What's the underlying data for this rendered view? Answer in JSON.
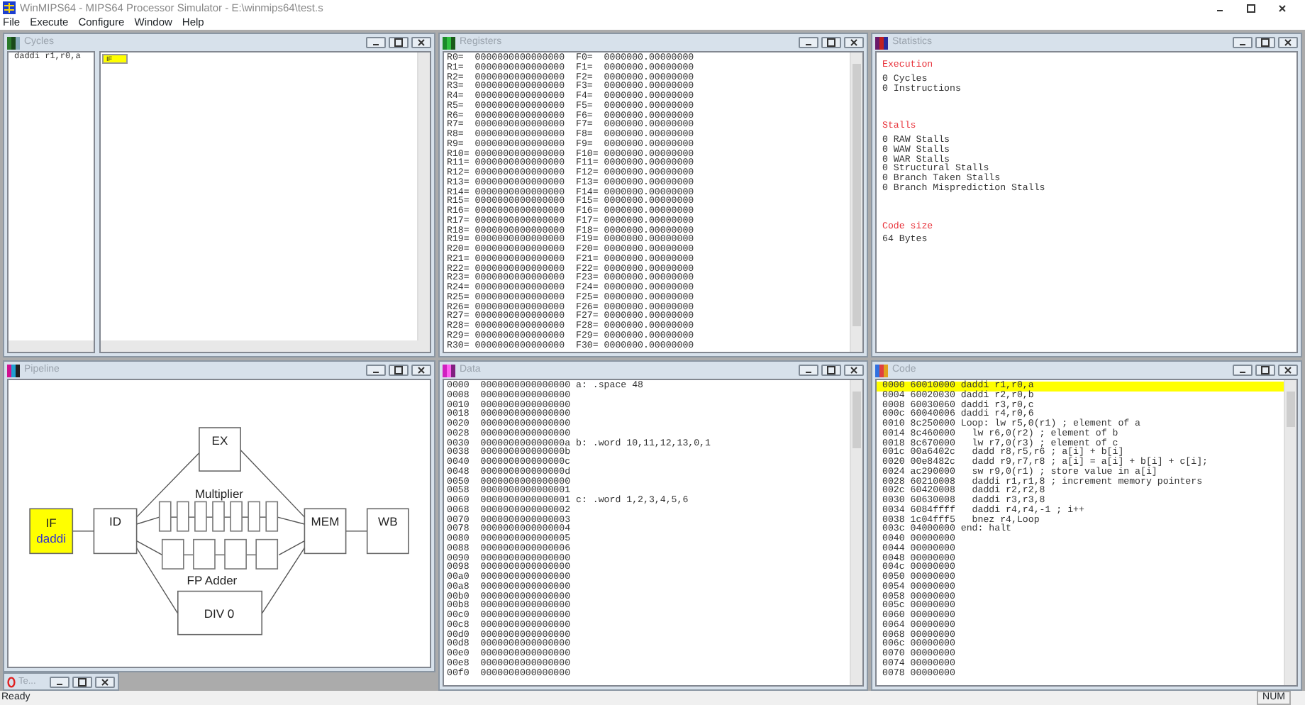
{
  "window": {
    "title": "WinMIPS64 - MIPS64 Processor Simulator - E:\\winmips64\\test.s"
  },
  "menu": [
    "File",
    "Execute",
    "Configure",
    "Window",
    "Help"
  ],
  "cycles": {
    "title": "Cycles",
    "instructions": [
      "daddi r1,r0,a"
    ],
    "stages": [
      "IF"
    ]
  },
  "registers": {
    "title": "Registers",
    "rows": [
      {
        "r": "R0=",
        "r_value": "0000000000000000",
        "f": "F0=",
        "f_value": "0000000.00000000"
      },
      {
        "r": "R1=",
        "r_value": "0000000000000000",
        "f": "F1=",
        "f_value": "0000000.00000000"
      },
      {
        "r": "R2=",
        "r_value": "0000000000000000",
        "f": "F2=",
        "f_value": "0000000.00000000"
      },
      {
        "r": "R3=",
        "r_value": "0000000000000000",
        "f": "F3=",
        "f_value": "0000000.00000000"
      },
      {
        "r": "R4=",
        "r_value": "0000000000000000",
        "f": "F4=",
        "f_value": "0000000.00000000"
      },
      {
        "r": "R5=",
        "r_value": "0000000000000000",
        "f": "F5=",
        "f_value": "0000000.00000000"
      },
      {
        "r": "R6=",
        "r_value": "0000000000000000",
        "f": "F6=",
        "f_value": "0000000.00000000"
      },
      {
        "r": "R7=",
        "r_value": "0000000000000000",
        "f": "F7=",
        "f_value": "0000000.00000000"
      },
      {
        "r": "R8=",
        "r_value": "0000000000000000",
        "f": "F8=",
        "f_value": "0000000.00000000"
      },
      {
        "r": "R9=",
        "r_value": "0000000000000000",
        "f": "F9=",
        "f_value": "0000000.00000000"
      },
      {
        "r": "R10=",
        "r_value": "0000000000000000",
        "f": "F10=",
        "f_value": "0000000.00000000"
      },
      {
        "r": "R11=",
        "r_value": "0000000000000000",
        "f": "F11=",
        "f_value": "0000000.00000000"
      },
      {
        "r": "R12=",
        "r_value": "0000000000000000",
        "f": "F12=",
        "f_value": "0000000.00000000"
      },
      {
        "r": "R13=",
        "r_value": "0000000000000000",
        "f": "F13=",
        "f_value": "0000000.00000000"
      },
      {
        "r": "R14=",
        "r_value": "0000000000000000",
        "f": "F14=",
        "f_value": "0000000.00000000"
      },
      {
        "r": "R15=",
        "r_value": "0000000000000000",
        "f": "F15=",
        "f_value": "0000000.00000000"
      },
      {
        "r": "R16=",
        "r_value": "0000000000000000",
        "f": "F16=",
        "f_value": "0000000.00000000"
      },
      {
        "r": "R17=",
        "r_value": "0000000000000000",
        "f": "F17=",
        "f_value": "0000000.00000000"
      },
      {
        "r": "R18=",
        "r_value": "0000000000000000",
        "f": "F18=",
        "f_value": "0000000.00000000"
      },
      {
        "r": "R19=",
        "r_value": "0000000000000000",
        "f": "F19=",
        "f_value": "0000000.00000000"
      },
      {
        "r": "R20=",
        "r_value": "0000000000000000",
        "f": "F20=",
        "f_value": "0000000.00000000"
      },
      {
        "r": "R21=",
        "r_value": "0000000000000000",
        "f": "F21=",
        "f_value": "0000000.00000000"
      },
      {
        "r": "R22=",
        "r_value": "0000000000000000",
        "f": "F22=",
        "f_value": "0000000.00000000"
      },
      {
        "r": "R23=",
        "r_value": "0000000000000000",
        "f": "F23=",
        "f_value": "0000000.00000000"
      },
      {
        "r": "R24=",
        "r_value": "0000000000000000",
        "f": "F24=",
        "f_value": "0000000.00000000"
      },
      {
        "r": "R25=",
        "r_value": "0000000000000000",
        "f": "F25=",
        "f_value": "0000000.00000000"
      },
      {
        "r": "R26=",
        "r_value": "0000000000000000",
        "f": "F26=",
        "f_value": "0000000.00000000"
      },
      {
        "r": "R27=",
        "r_value": "0000000000000000",
        "f": "F27=",
        "f_value": "0000000.00000000"
      },
      {
        "r": "R28=",
        "r_value": "0000000000000000",
        "f": "F28=",
        "f_value": "0000000.00000000"
      },
      {
        "r": "R29=",
        "r_value": "0000000000000000",
        "f": "F29=",
        "f_value": "0000000.00000000"
      },
      {
        "r": "R30=",
        "r_value": "0000000000000000",
        "f": "F30=",
        "f_value": "0000000.00000000"
      }
    ]
  },
  "statistics": {
    "title": "Statistics",
    "sections": [
      {
        "heading": "Execution",
        "lines": [
          "0 Cycles",
          "0 Instructions"
        ]
      },
      {
        "heading": "Stalls",
        "lines": [
          "0 RAW Stalls",
          "0 WAW Stalls",
          "0 WAR Stalls",
          "0 Structural Stalls",
          "0 Branch Taken Stalls",
          "0 Branch Misprediction Stalls"
        ]
      },
      {
        "heading": "Code size",
        "lines": [
          "64 Bytes"
        ]
      }
    ]
  },
  "pipeline": {
    "title": "Pipeline",
    "stages": [
      {
        "label": "IF",
        "instruction": "daddi",
        "active": true
      },
      {
        "label": "ID",
        "active": false
      },
      {
        "label": "EX",
        "active": false
      },
      {
        "label": "MEM",
        "active": false
      },
      {
        "label": "WB",
        "active": false
      }
    ],
    "multiplier": {
      "label": "Multiplier"
    },
    "fp_adder": {
      "label": "FP Adder"
    },
    "divider": {
      "label": "DIV 0"
    }
  },
  "minimized_window": {
    "title": "Te..."
  },
  "data": {
    "title": "Data",
    "rows": [
      {
        "address": "0000",
        "value": "0000000000000000",
        "label": "a: .space 48"
      },
      {
        "address": "0008",
        "value": "0000000000000000"
      },
      {
        "address": "0010",
        "value": "0000000000000000"
      },
      {
        "address": "0018",
        "value": "0000000000000000"
      },
      {
        "address": "0020",
        "value": "0000000000000000"
      },
      {
        "address": "0028",
        "value": "0000000000000000"
      },
      {
        "address": "0030",
        "value": "000000000000000a",
        "label": "b: .word 10,11,12,13,0,1"
      },
      {
        "address": "0038",
        "value": "000000000000000b"
      },
      {
        "address": "0040",
        "value": "000000000000000c"
      },
      {
        "address": "0048",
        "value": "000000000000000d"
      },
      {
        "address": "0050",
        "value": "0000000000000000"
      },
      {
        "address": "0058",
        "value": "0000000000000001"
      },
      {
        "address": "0060",
        "value": "0000000000000001",
        "label": "c: .word 1,2,3,4,5,6"
      },
      {
        "address": "0068",
        "value": "0000000000000002"
      },
      {
        "address": "0070",
        "value": "0000000000000003"
      },
      {
        "address": "0078",
        "value": "0000000000000004"
      },
      {
        "address": "0080",
        "value": "0000000000000005"
      },
      {
        "address": "0088",
        "value": "0000000000000006"
      },
      {
        "address": "0090",
        "value": "0000000000000000"
      },
      {
        "address": "0098",
        "value": "0000000000000000"
      },
      {
        "address": "00a0",
        "value": "0000000000000000"
      },
      {
        "address": "00a8",
        "value": "0000000000000000"
      },
      {
        "address": "00b0",
        "value": "0000000000000000"
      },
      {
        "address": "00b8",
        "value": "0000000000000000"
      },
      {
        "address": "00c0",
        "value": "0000000000000000"
      },
      {
        "address": "00c8",
        "value": "0000000000000000"
      },
      {
        "address": "00d0",
        "value": "0000000000000000"
      },
      {
        "address": "00d8",
        "value": "0000000000000000"
      },
      {
        "address": "00e0",
        "value": "0000000000000000"
      },
      {
        "address": "00e8",
        "value": "0000000000000000"
      },
      {
        "address": "00f0",
        "value": "0000000000000000"
      }
    ]
  },
  "code": {
    "title": "Code",
    "rows": [
      {
        "address": "0000",
        "word": "60010000",
        "source": "daddi r1,r0,a",
        "indented": false,
        "selected": true
      },
      {
        "address": "0004",
        "word": "60020030",
        "source": "daddi r2,r0,b",
        "indented": false,
        "selected": false
      },
      {
        "address": "0008",
        "word": "60030060",
        "source": "daddi r3,r0,c",
        "indented": false,
        "selected": false
      },
      {
        "address": "000c",
        "word": "60040006",
        "source": "daddi r4,r0,6",
        "indented": false,
        "selected": false
      },
      {
        "address": "0010",
        "word": "8c250000",
        "source": "Loop: lw r5,0(r1) ; element of a",
        "indented": false,
        "selected": false
      },
      {
        "address": "0014",
        "word": "8c460000",
        "source": "lw r6,0(r2) ; element of b",
        "indented": true,
        "selected": false
      },
      {
        "address": "0018",
        "word": "8c670000",
        "source": "lw r7,0(r3) ; element of c",
        "indented": true,
        "selected": false
      },
      {
        "address": "001c",
        "word": "00a6402c",
        "source": "dadd r8,r5,r6 ; a[i] + b[i]",
        "indented": true,
        "selected": false
      },
      {
        "address": "0020",
        "word": "00e8482c",
        "source": "dadd r9,r7,r8 ; a[i] = a[i] + b[i] + c[i];",
        "indented": true,
        "selected": false
      },
      {
        "address": "0024",
        "word": "ac290000",
        "source": "sw r9,0(r1) ; store value in a[i]",
        "indented": true,
        "selected": false
      },
      {
        "address": "0028",
        "word": "60210008",
        "source": "daddi r1,r1,8 ; increment memory pointers",
        "indented": true,
        "selected": false
      },
      {
        "address": "002c",
        "word": "60420008",
        "source": "daddi r2,r2,8",
        "indented": true,
        "selected": false
      },
      {
        "address": "0030",
        "word": "60630008",
        "source": "daddi r3,r3,8",
        "indented": true,
        "selected": false
      },
      {
        "address": "0034",
        "word": "6084ffff",
        "source": "daddi r4,r4,-1 ; i++",
        "indented": true,
        "selected": false
      },
      {
        "address": "0038",
        "word": "1c04fff5",
        "source": "bnez r4,Loop",
        "indented": true,
        "selected": false
      },
      {
        "address": "003c",
        "word": "04000000",
        "source": "end: halt",
        "indented": false,
        "selected": false
      },
      {
        "address": "0040",
        "word": "00000000"
      },
      {
        "address": "0044",
        "word": "00000000"
      },
      {
        "address": "0048",
        "word": "00000000"
      },
      {
        "address": "004c",
        "word": "00000000"
      },
      {
        "address": "0050",
        "word": "00000000"
      },
      {
        "address": "0054",
        "word": "00000000"
      },
      {
        "address": "0058",
        "word": "00000000"
      },
      {
        "address": "005c",
        "word": "00000000"
      },
      {
        "address": "0060",
        "word": "00000000"
      },
      {
        "address": "0064",
        "word": "00000000"
      },
      {
        "address": "0068",
        "word": "00000000"
      },
      {
        "address": "006c",
        "word": "00000000"
      },
      {
        "address": "0070",
        "word": "00000000"
      },
      {
        "address": "0074",
        "word": "00000000"
      },
      {
        "address": "0078",
        "word": "00000000"
      }
    ]
  },
  "status_bar": {
    "message": "Ready",
    "indicators": [
      "NUM"
    ]
  }
}
